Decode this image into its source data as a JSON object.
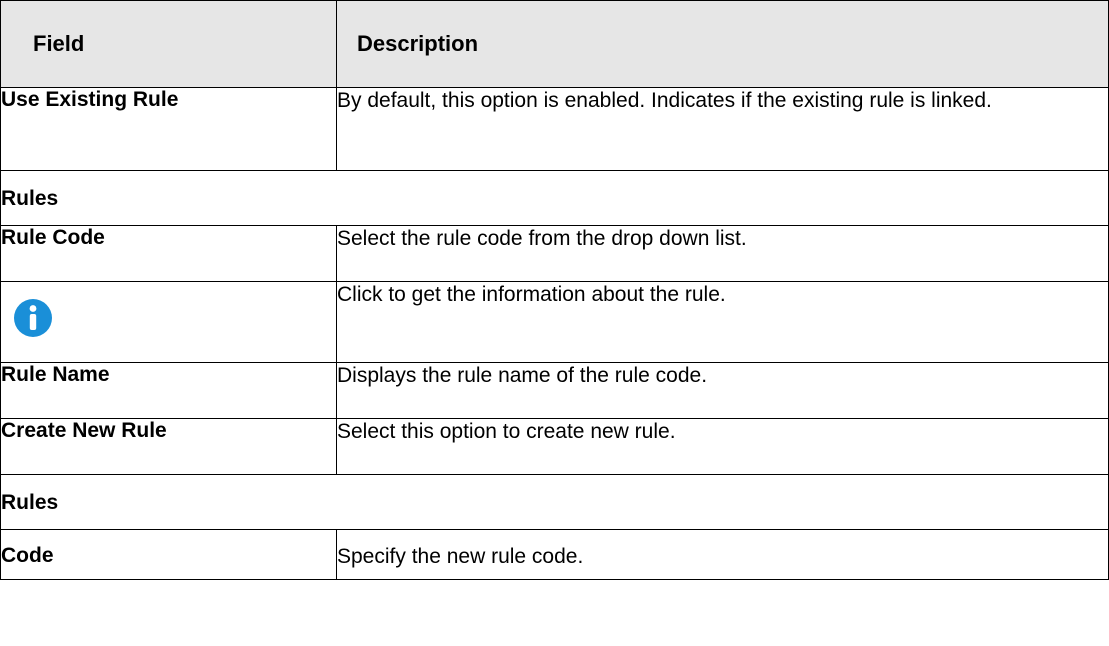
{
  "table": {
    "header": {
      "field": "Field",
      "description": "Description"
    },
    "rows": [
      {
        "field": "Use Existing Rule",
        "description": "By default, this option is enabled. Indicates if the existing rule is linked."
      },
      {
        "section": "Rules"
      },
      {
        "field": "Rule Code",
        "description": "Select the rule code from the drop down list."
      },
      {
        "icon": "info-icon",
        "description": "Click to get the information about the rule."
      },
      {
        "field": "Rule Name",
        "description": "Displays the rule name of the rule code."
      },
      {
        "field": "Create New Rule",
        "description": "Select this option to create new rule."
      },
      {
        "section": "Rules"
      },
      {
        "field": "Code",
        "description": "Specify the new rule code."
      }
    ]
  },
  "colors": {
    "header_bg": "#e6e6e6",
    "border": "#000000",
    "info_icon": "#1a8fd8"
  }
}
